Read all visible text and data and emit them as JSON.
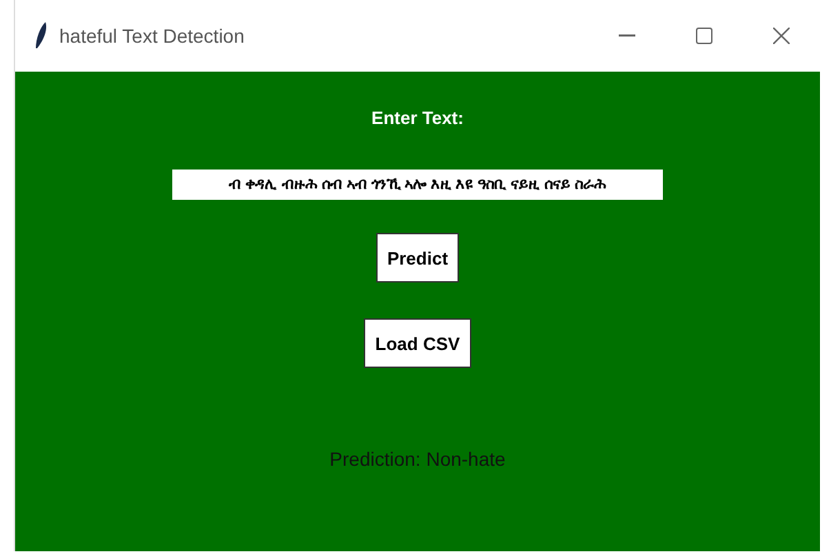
{
  "window": {
    "title": "hateful Text Detection"
  },
  "prompt": "Enter Text:",
  "input": {
    "value": "ብ ቀዳሊ ብዙሕ ሰብ ኣብ ጎንኺ ኣሎ እዚ እዩ ዓስቢ ናይዚ ሰናይ ስራሕ"
  },
  "buttons": [
    "Predict",
    "Load CSV"
  ],
  "result": "Prediction: Non-hate"
}
